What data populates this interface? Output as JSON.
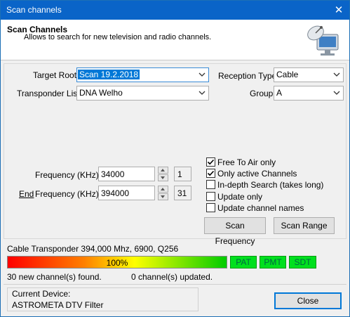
{
  "window": {
    "title": "Scan channels"
  },
  "header": {
    "title": "Scan Channels",
    "subtitle": "Allows to search for new television and radio channels."
  },
  "form": {
    "target_root_label": "Target Root",
    "target_root_value": "Scan 19.2.2018",
    "transponder_list_label": "Transponder List",
    "transponder_list_value": "DNA Welho",
    "reception_type_label": "Reception Type",
    "reception_type_value": "Cable",
    "group_label": "Group",
    "group_value": "A",
    "frequency_label": "Frequency (KHz)",
    "frequency_value": "34000",
    "frequency_index": "1",
    "end_label": "End",
    "end_frequency_label": "Frequency (KHz)",
    "end_frequency_value": "394000",
    "end_frequency_index": "31"
  },
  "options": [
    {
      "label": "Free To Air only",
      "checked": true
    },
    {
      "label": "Only active Channels",
      "checked": true
    },
    {
      "label": "In-depth Search (takes long)",
      "checked": false
    },
    {
      "label": "Update only",
      "checked": false
    },
    {
      "label": "Update channel names",
      "checked": false
    }
  ],
  "buttons": {
    "scan_frequency": "Scan Frequency",
    "scan_range": "Scan Range",
    "close": "Close"
  },
  "status": {
    "transponder_text": "Cable Transponder 394,000 Mhz, 6900, Q256",
    "progress_text": "100%",
    "progress_fraction": 1.0,
    "tags": [
      "PAT",
      "PMT",
      "SDT"
    ],
    "channels_found": "30 new channel(s) found.",
    "channels_updated": "0 channel(s) updated."
  },
  "device": {
    "caption": "Current Device:",
    "name": "ASTROMETA DTV Filter"
  },
  "colors": {
    "titlebar": "#0a64c8",
    "selection": "#0078d7",
    "tag_green": "#00e01e"
  }
}
